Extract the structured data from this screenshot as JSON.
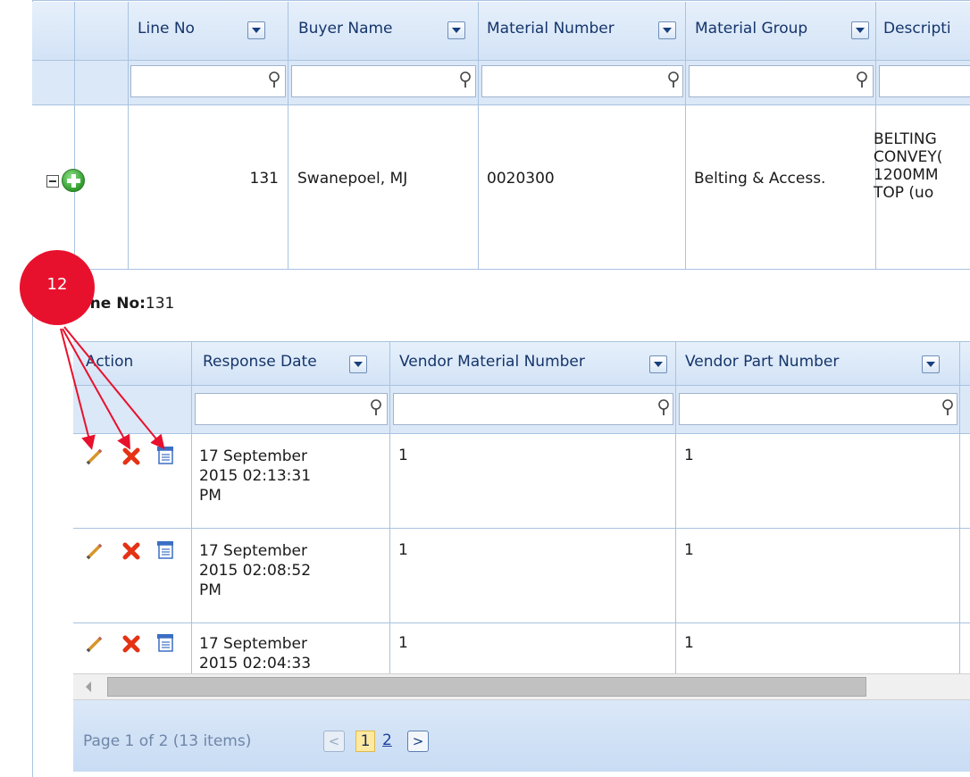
{
  "main_grid": {
    "columns": [
      "Line No",
      "Buyer Name",
      "Material Number",
      "Material Group",
      "Descripti"
    ],
    "row": {
      "line_no": "131",
      "buyer_name": "Swanepoel, MJ",
      "material_number": "0020300",
      "material_group": "Belting & Access.",
      "description_lines": [
        "BELTING",
        "CONVEY(",
        "1200MM",
        "TOP (uo"
      ]
    }
  },
  "detail": {
    "label": "Line No:",
    "value": "131",
    "columns": [
      "Action",
      "Response Date",
      "Vendor Material Number",
      "Vendor Part Number"
    ],
    "rows": [
      {
        "date_lines": [
          "17 September",
          "2015 02:13:31",
          "PM"
        ],
        "vendor_material": "1",
        "vendor_part": "1"
      },
      {
        "date_lines": [
          "17 September",
          "2015 02:08:52",
          "PM"
        ],
        "vendor_material": "1",
        "vendor_part": "1"
      },
      {
        "date_lines": [
          "17 September",
          "2015 02:04:33",
          ""
        ],
        "vendor_material": "1",
        "vendor_part": "1"
      }
    ],
    "pager": {
      "summary": "Page 1 of 2 (13 items)",
      "current_page": "1",
      "next_page": "2",
      "prev_glyph": "<",
      "next_glyph": ">"
    }
  },
  "annotation": {
    "badge_text": "12",
    "color": "#e8112d"
  }
}
